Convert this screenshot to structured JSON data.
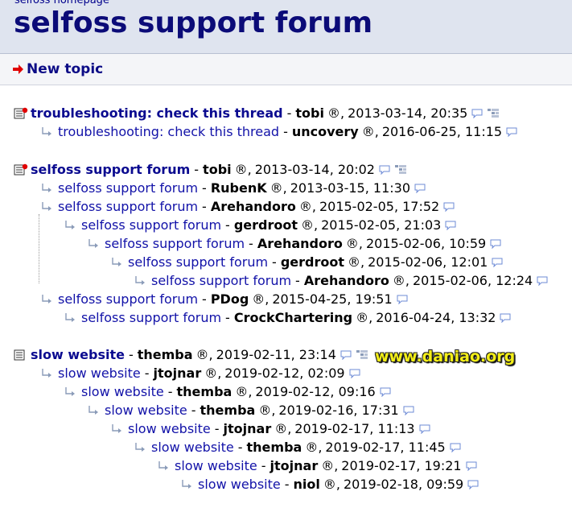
{
  "header": {
    "home_link": "selfoss homepage",
    "title": "selfoss support forum"
  },
  "toolbar": {
    "new_topic_label": "New topic"
  },
  "registered_symbol": "®",
  "colors": {
    "header_bg": "#dfe4ef",
    "link": "#1212a8",
    "title": "#0b0b78",
    "new_indicator": "#e00000",
    "arrow": "#e00000"
  },
  "threads": [
    {
      "rows": [
        {
          "subject": "troubleshooting: check this thread",
          "author": "tobi",
          "datetime": "2013-03-14, 20:35",
          "top": true,
          "new": true
        },
        {
          "subject": "troubleshooting: check this thread",
          "author": "uncovery",
          "datetime": "2016-06-25, 11:15"
        }
      ]
    },
    {
      "rows": [
        {
          "subject": "selfoss support forum",
          "author": "tobi",
          "datetime": "2013-03-14, 20:02",
          "top": true,
          "new": true
        },
        {
          "subject": "selfoss support forum",
          "author": "RubenK",
          "datetime": "2013-03-15, 11:30"
        },
        {
          "subject": "selfoss support forum",
          "author": "Arehandoro",
          "datetime": "2015-02-05, 17:52"
        },
        {
          "subject": "selfoss support forum",
          "author": "gerdroot",
          "datetime": "2015-02-05, 21:03"
        },
        {
          "subject": "selfoss support forum",
          "author": "Arehandoro",
          "datetime": "2015-02-06, 10:59"
        },
        {
          "subject": "selfoss support forum",
          "author": "gerdroot",
          "datetime": "2015-02-06, 12:01"
        },
        {
          "subject": "selfoss support forum",
          "author": "Arehandoro",
          "datetime": "2015-02-06, 12:24"
        },
        {
          "subject": "selfoss support forum",
          "author": "PDog",
          "datetime": "2015-04-25, 19:51"
        },
        {
          "subject": "selfoss support forum",
          "author": "CrockChartering",
          "datetime": "2016-04-24, 13:32"
        }
      ]
    },
    {
      "rows": [
        {
          "subject": "slow website",
          "author": "themba",
          "datetime": "2019-02-11, 23:14",
          "top": true,
          "new": false
        },
        {
          "subject": "slow website",
          "author": "jtojnar",
          "datetime": "2019-02-12, 02:09"
        },
        {
          "subject": "slow website",
          "author": "themba",
          "datetime": "2019-02-12, 09:16"
        },
        {
          "subject": "slow website",
          "author": "themba",
          "datetime": "2019-02-16, 17:31"
        },
        {
          "subject": "slow website",
          "author": "jtojnar",
          "datetime": "2019-02-17, 11:13"
        },
        {
          "subject": "slow website",
          "author": "themba",
          "datetime": "2019-02-17, 11:45"
        },
        {
          "subject": "slow website",
          "author": "jtojnar",
          "datetime": "2019-02-17, 19:21"
        },
        {
          "subject": "slow website",
          "author": "niol",
          "datetime": "2019-02-18, 09:59"
        }
      ]
    }
  ],
  "watermark": "www.daniao.org"
}
